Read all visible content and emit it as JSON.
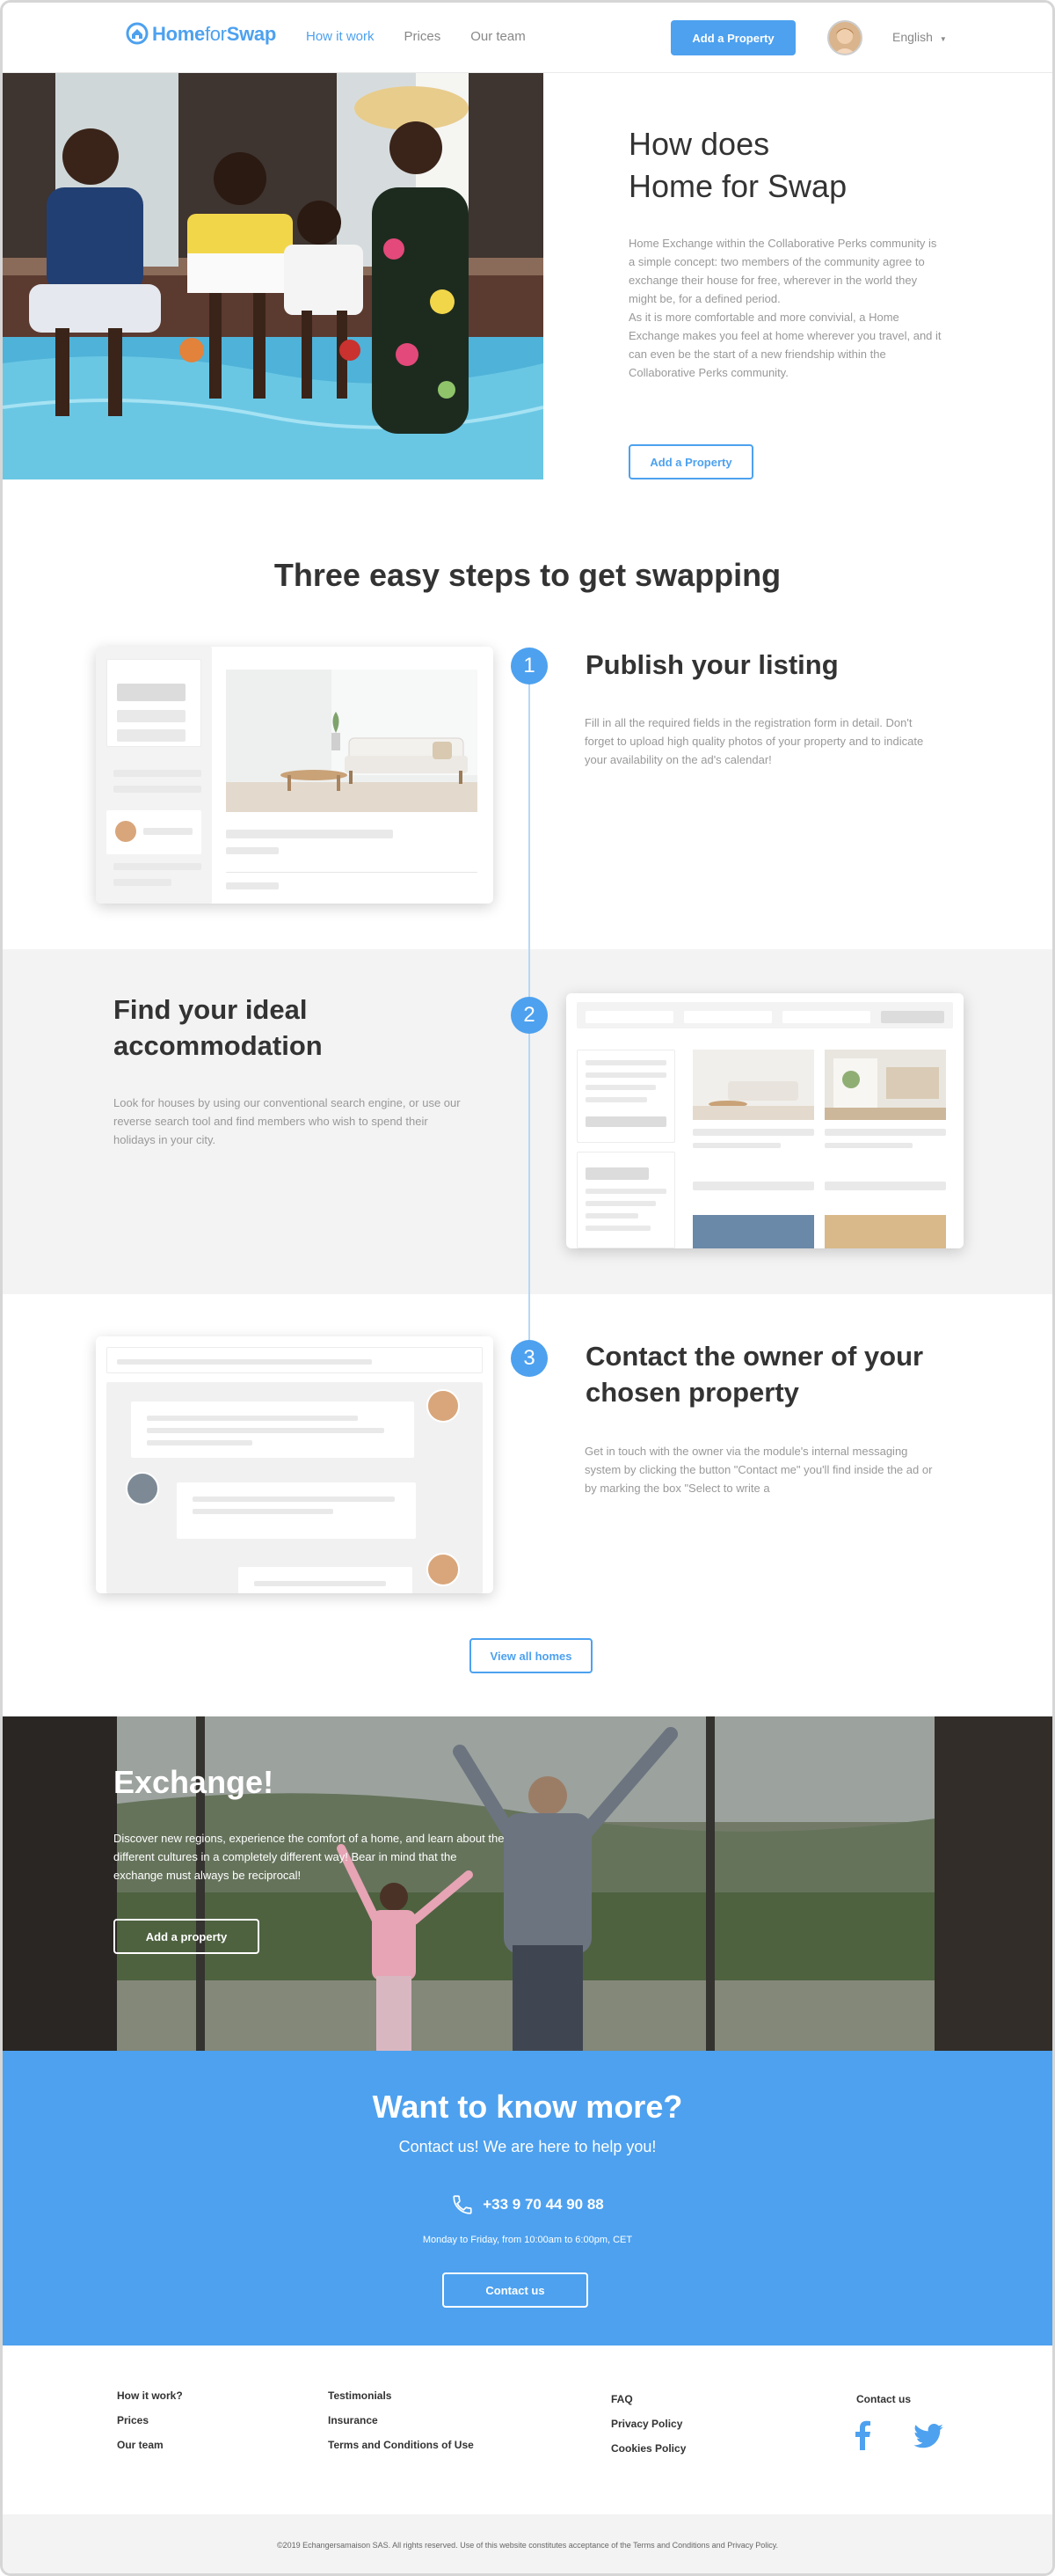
{
  "header": {
    "logo": {
      "home": "Home",
      "for": "for",
      "swap": "Swap"
    },
    "nav": [
      {
        "label": "How it work",
        "active": true
      },
      {
        "label": "Prices",
        "active": false
      },
      {
        "label": "Our team",
        "active": false
      }
    ],
    "add_property_button": "Add a Property",
    "language": "English"
  },
  "hero": {
    "title_line1": "How does",
    "title_line2": "Home for Swap",
    "paragraph1": "Home Exchange within the Collaborative Perks community is a simple concept: two members of the community agree to exchange their house for free, wherever in the world they might be, for a defined period.",
    "paragraph2": "As it is more comfortable and more convivial, a Home Exchange makes you feel at home wherever you travel, and it can even be the start of a new friendship within the Collaborative Perks community.",
    "button": "Add a Property"
  },
  "steps_section": {
    "title": "Three easy steps to get swapping",
    "steps": [
      {
        "number": "1",
        "title": "Publish your listing",
        "description": "Fill in all the required fields in the registration form in detail. Don't forget to upload high quality photos of your property and to indicate your availability on the ad's calendar!"
      },
      {
        "number": "2",
        "title": "Find your ideal accommodation",
        "description": "Look for houses by using our conventional search engine, or use our reverse search tool and find members who wish to spend their holidays in your city."
      },
      {
        "number": "3",
        "title": "Contact the owner of your chosen property",
        "description": "Get in touch with the owner via the module's internal messaging system by clicking the button \"Contact me\" you'll find inside the ad or by marking the box \"Select to write a"
      }
    ],
    "view_all_button": "View all homes"
  },
  "exchange": {
    "title": "Exchange!",
    "body": "Discover new regions, experience the comfort of a home, and learn about the different cultures in a completely different way! Bear in mind that the exchange must always be reciprocal!",
    "button": "Add a property"
  },
  "contact": {
    "title": "Want to know more?",
    "subtitle": "Contact us! We are here to help you!",
    "phone": "+33 9 70 44 90 88",
    "hours": "Monday to Friday, from 10:00am to 6:00pm, CET",
    "button": "Contact us"
  },
  "footer": {
    "col1": [
      "How it work?",
      "Prices",
      "Our team"
    ],
    "col2": [
      "Testimonials",
      "Insurance",
      "Terms and Conditions of Use"
    ],
    "col3": [
      "FAQ",
      "Privacy Policy",
      "Cookies Policy"
    ],
    "contact_label": "Contact us",
    "copyright": "©2019 Echangersamaison SAS. All rights reserved. Use of this website constitutes acceptance of the Terms and Conditions and Privacy Policy."
  },
  "colors": {
    "accent": "#4da1ef",
    "band": "#f3f3f3",
    "text_dark": "#333333",
    "text_muted": "#999999"
  },
  "icons": [
    "home-logo-icon",
    "chevron-down-icon",
    "phone-icon",
    "facebook-icon",
    "twitter-icon"
  ]
}
